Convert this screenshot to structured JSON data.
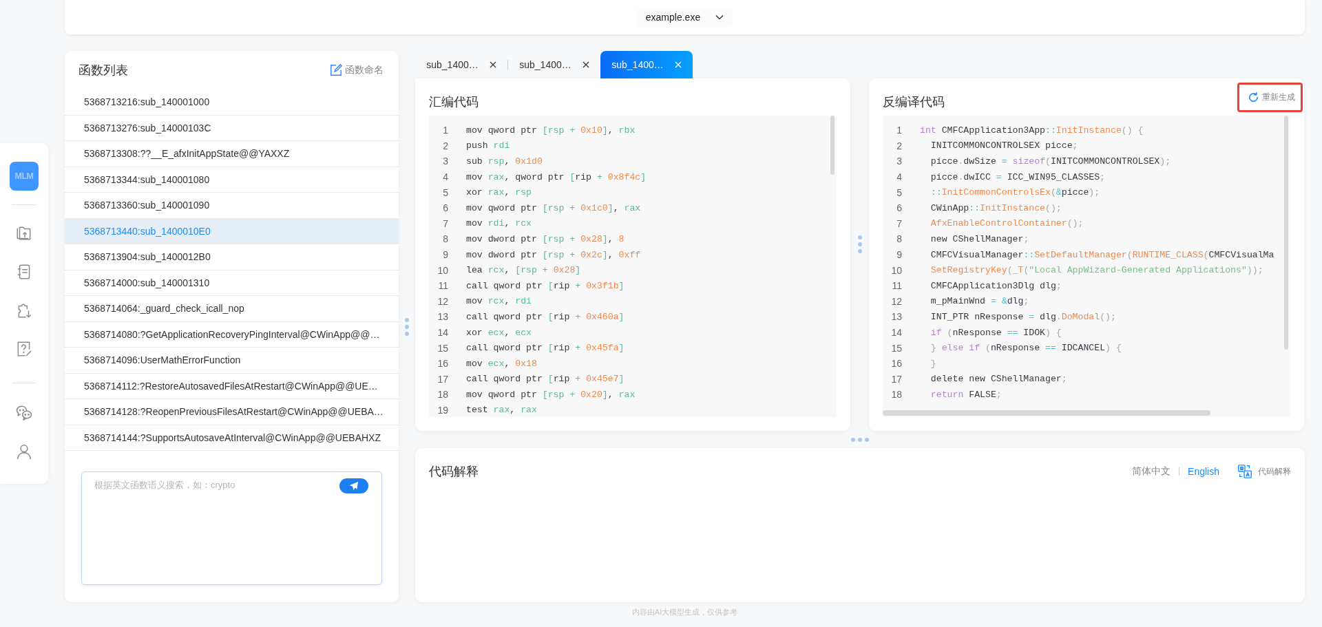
{
  "top_bar": {
    "file_select": "example.exe"
  },
  "rail": {
    "logo": "MLM"
  },
  "function_list": {
    "title": "函数列表",
    "rename_button": "函数命名",
    "items": [
      {
        "label": "5368713216:sub_140001000",
        "selected": false
      },
      {
        "label": "5368713276:sub_14000103C",
        "selected": false
      },
      {
        "label": "5368713308:??__E_afxInitAppState@@YAXXZ",
        "selected": false
      },
      {
        "label": "5368713344:sub_140001080",
        "selected": false
      },
      {
        "label": "5368713360:sub_140001090",
        "selected": false
      },
      {
        "label": "5368713440:sub_1400010E0",
        "selected": true
      },
      {
        "label": "5368713904:sub_1400012B0",
        "selected": false
      },
      {
        "label": "5368714000:sub_140001310",
        "selected": false
      },
      {
        "label": "5368714064:_guard_check_icall_nop",
        "selected": false
      },
      {
        "label": "5368714080:?GetApplicationRecoveryPingInterval@CWinApp@@…",
        "selected": false
      },
      {
        "label": "5368714096:UserMathErrorFunction",
        "selected": false
      },
      {
        "label": "5368714112:?RestoreAutosavedFilesAtRestart@CWinApp@@UE…",
        "selected": false
      },
      {
        "label": "5368714128:?ReopenPreviousFilesAtRestart@CWinApp@@UEBA…",
        "selected": false
      },
      {
        "label": "5368714144:?SupportsAutosaveAtInterval@CWinApp@@UEBAHXZ",
        "selected": false
      }
    ],
    "search": {
      "placeholder": "根据英文函数语义搜索，如：crypto"
    }
  },
  "tabs": [
    {
      "label": "sub_1400…",
      "selected": false
    },
    {
      "label": "sub_1400…",
      "selected": false
    },
    {
      "label": "sub_1400…",
      "selected": true
    }
  ],
  "assembly": {
    "title": "汇编代码",
    "lines": [
      {
        "number": "1",
        "tokens": [
          {
            "kind": "plain",
            "text": "mov qword ptr "
          },
          {
            "kind": "accent",
            "text": "[rsp + "
          },
          {
            "kind": "number",
            "text": "0x10"
          },
          {
            "kind": "accent",
            "text": "]"
          },
          {
            "kind": "plain",
            "text": ", "
          },
          {
            "kind": "accent",
            "text": "rbx"
          }
        ]
      },
      {
        "number": "2",
        "tokens": [
          {
            "kind": "plain",
            "text": "push "
          },
          {
            "kind": "accent",
            "text": "rdi"
          }
        ]
      },
      {
        "number": "3",
        "tokens": [
          {
            "kind": "plain",
            "text": "sub "
          },
          {
            "kind": "accent",
            "text": "rsp"
          },
          {
            "kind": "plain",
            "text": ", "
          },
          {
            "kind": "number",
            "text": "0x1d0"
          }
        ]
      },
      {
        "number": "4",
        "tokens": [
          {
            "kind": "plain",
            "text": "mov "
          },
          {
            "kind": "accent",
            "text": "rax"
          },
          {
            "kind": "plain",
            "text": ", qword ptr "
          },
          {
            "kind": "accent",
            "text": "["
          },
          {
            "kind": "plain",
            "text": "rip "
          },
          {
            "kind": "accent",
            "text": "+ "
          },
          {
            "kind": "number",
            "text": "0x8f4c"
          },
          {
            "kind": "accent",
            "text": "]"
          }
        ]
      },
      {
        "number": "5",
        "tokens": [
          {
            "kind": "plain",
            "text": "xor "
          },
          {
            "kind": "accent",
            "text": "rax"
          },
          {
            "kind": "plain",
            "text": ", "
          },
          {
            "kind": "accent",
            "text": "rsp"
          }
        ]
      },
      {
        "number": "6",
        "tokens": [
          {
            "kind": "plain",
            "text": "mov qword ptr "
          },
          {
            "kind": "accent",
            "text": "[rsp + "
          },
          {
            "kind": "number",
            "text": "0x1c0"
          },
          {
            "kind": "accent",
            "text": "]"
          },
          {
            "kind": "plain",
            "text": ", "
          },
          {
            "kind": "accent",
            "text": "rax"
          }
        ]
      },
      {
        "number": "7",
        "tokens": [
          {
            "kind": "plain",
            "text": "mov "
          },
          {
            "kind": "accent",
            "text": "rdi"
          },
          {
            "kind": "plain",
            "text": ", "
          },
          {
            "kind": "accent",
            "text": "rcx"
          }
        ]
      },
      {
        "number": "8",
        "tokens": [
          {
            "kind": "plain",
            "text": "mov dword ptr "
          },
          {
            "kind": "accent",
            "text": "[rsp + "
          },
          {
            "kind": "number",
            "text": "0x28"
          },
          {
            "kind": "accent",
            "text": "]"
          },
          {
            "kind": "plain",
            "text": ", "
          },
          {
            "kind": "number",
            "text": "8"
          }
        ]
      },
      {
        "number": "9",
        "tokens": [
          {
            "kind": "plain",
            "text": "mov dword ptr "
          },
          {
            "kind": "accent",
            "text": "[rsp + "
          },
          {
            "kind": "number",
            "text": "0x2c"
          },
          {
            "kind": "accent",
            "text": "]"
          },
          {
            "kind": "plain",
            "text": ", "
          },
          {
            "kind": "number",
            "text": "0xff"
          }
        ]
      },
      {
        "number": "10",
        "tokens": [
          {
            "kind": "plain",
            "text": "lea "
          },
          {
            "kind": "accent",
            "text": "rcx"
          },
          {
            "kind": "plain",
            "text": ", "
          },
          {
            "kind": "accent",
            "text": "[rsp + "
          },
          {
            "kind": "number",
            "text": "0x28"
          },
          {
            "kind": "accent",
            "text": "]"
          }
        ]
      },
      {
        "number": "11",
        "tokens": [
          {
            "kind": "plain",
            "text": "call qword ptr "
          },
          {
            "kind": "accent",
            "text": "["
          },
          {
            "kind": "plain",
            "text": "rip "
          },
          {
            "kind": "accent",
            "text": "+ "
          },
          {
            "kind": "number",
            "text": "0x3f1b"
          },
          {
            "kind": "accent",
            "text": "]"
          }
        ]
      },
      {
        "number": "12",
        "tokens": [
          {
            "kind": "plain",
            "text": "mov "
          },
          {
            "kind": "accent",
            "text": "rcx"
          },
          {
            "kind": "plain",
            "text": ", "
          },
          {
            "kind": "accent",
            "text": "rdi"
          }
        ]
      },
      {
        "number": "13",
        "tokens": [
          {
            "kind": "plain",
            "text": "call qword ptr "
          },
          {
            "kind": "accent",
            "text": "["
          },
          {
            "kind": "plain",
            "text": "rip "
          },
          {
            "kind": "accent",
            "text": "+ "
          },
          {
            "kind": "number",
            "text": "0x460a"
          },
          {
            "kind": "accent",
            "text": "]"
          }
        ]
      },
      {
        "number": "14",
        "tokens": [
          {
            "kind": "plain",
            "text": "xor "
          },
          {
            "kind": "accent",
            "text": "ecx"
          },
          {
            "kind": "plain",
            "text": ", "
          },
          {
            "kind": "accent",
            "text": "ecx"
          }
        ]
      },
      {
        "number": "15",
        "tokens": [
          {
            "kind": "plain",
            "text": "call qword ptr "
          },
          {
            "kind": "accent",
            "text": "["
          },
          {
            "kind": "plain",
            "text": "rip "
          },
          {
            "kind": "accent",
            "text": "+ "
          },
          {
            "kind": "number",
            "text": "0x45fa"
          },
          {
            "kind": "accent",
            "text": "]"
          }
        ]
      },
      {
        "number": "16",
        "tokens": [
          {
            "kind": "plain",
            "text": "mov "
          },
          {
            "kind": "accent",
            "text": "ecx"
          },
          {
            "kind": "plain",
            "text": ", "
          },
          {
            "kind": "number",
            "text": "0x18"
          }
        ]
      },
      {
        "number": "17",
        "tokens": [
          {
            "kind": "plain",
            "text": "call qword ptr "
          },
          {
            "kind": "accent",
            "text": "["
          },
          {
            "kind": "plain",
            "text": "rip "
          },
          {
            "kind": "accent",
            "text": "+ "
          },
          {
            "kind": "number",
            "text": "0x45e7"
          },
          {
            "kind": "accent",
            "text": "]"
          }
        ]
      },
      {
        "number": "18",
        "tokens": [
          {
            "kind": "plain",
            "text": "mov qword ptr "
          },
          {
            "kind": "accent",
            "text": "[rsp + "
          },
          {
            "kind": "number",
            "text": "0x20"
          },
          {
            "kind": "accent",
            "text": "]"
          },
          {
            "kind": "plain",
            "text": ", "
          },
          {
            "kind": "accent",
            "text": "rax"
          }
        ]
      },
      {
        "number": "19",
        "tokens": [
          {
            "kind": "plain",
            "text": "test "
          },
          {
            "kind": "accent",
            "text": "rax"
          },
          {
            "kind": "plain",
            "text": ", "
          },
          {
            "kind": "accent",
            "text": "rax"
          }
        ]
      }
    ]
  },
  "decompiled": {
    "title": "反编译代码",
    "regenerate_button": {
      "label": "重新生成",
      "highlighted": true
    },
    "lines": [
      {
        "number": "1",
        "tokens": [
          {
            "kind": "keyword",
            "text": "int"
          },
          {
            "kind": "plain",
            "text": " CMFCApplication3App"
          },
          {
            "kind": "operator",
            "text": "::"
          },
          {
            "kind": "function",
            "text": "InitInstance"
          },
          {
            "kind": "punct",
            "text": "() {"
          }
        ]
      },
      {
        "number": "2",
        "tokens": [
          {
            "kind": "plain",
            "text": "  INITCOMMONCONTROLSEX picce"
          },
          {
            "kind": "punct",
            "text": ";"
          }
        ]
      },
      {
        "number": "3",
        "tokens": [
          {
            "kind": "plain",
            "text": "  picce"
          },
          {
            "kind": "punct",
            "text": "."
          },
          {
            "kind": "plain",
            "text": "dwSize "
          },
          {
            "kind": "operator",
            "text": "="
          },
          {
            "kind": "keyword",
            "text": " sizeof"
          },
          {
            "kind": "punct",
            "text": "("
          },
          {
            "kind": "plain",
            "text": "INITCOMMONCONTROLSEX"
          },
          {
            "kind": "punct",
            "text": ");"
          }
        ]
      },
      {
        "number": "4",
        "tokens": [
          {
            "kind": "plain",
            "text": "  picce"
          },
          {
            "kind": "punct",
            "text": "."
          },
          {
            "kind": "plain",
            "text": "dwICC "
          },
          {
            "kind": "operator",
            "text": "="
          },
          {
            "kind": "plain",
            "text": " ICC_WIN95_CLASSES"
          },
          {
            "kind": "punct",
            "text": ";"
          }
        ]
      },
      {
        "number": "5",
        "tokens": [
          {
            "kind": "operator",
            "text": "  ::"
          },
          {
            "kind": "function",
            "text": "InitCommonControlsEx"
          },
          {
            "kind": "punct",
            "text": "("
          },
          {
            "kind": "operator",
            "text": "&"
          },
          {
            "kind": "plain",
            "text": "picce"
          },
          {
            "kind": "punct",
            "text": ");"
          }
        ]
      },
      {
        "number": "6",
        "tokens": [
          {
            "kind": "plain",
            "text": "  CWinApp"
          },
          {
            "kind": "operator",
            "text": "::"
          },
          {
            "kind": "function",
            "text": "InitInstance"
          },
          {
            "kind": "punct",
            "text": "();"
          }
        ]
      },
      {
        "number": "7",
        "tokens": [
          {
            "kind": "function",
            "text": "  AfxEnableControlContainer"
          },
          {
            "kind": "punct",
            "text": "();"
          }
        ]
      },
      {
        "number": "8",
        "tokens": [
          {
            "kind": "plain",
            "text": "  new CShellManager"
          },
          {
            "kind": "punct",
            "text": ";"
          }
        ]
      },
      {
        "number": "9",
        "tokens": [
          {
            "kind": "plain",
            "text": "  CMFCVisualManager"
          },
          {
            "kind": "operator",
            "text": "::"
          },
          {
            "kind": "function",
            "text": "SetDefaultManager"
          },
          {
            "kind": "punct",
            "text": "("
          },
          {
            "kind": "function",
            "text": "RUNTIME_CLASS"
          },
          {
            "kind": "punct",
            "text": "("
          },
          {
            "kind": "plain",
            "text": "CMFCVisualMa"
          }
        ]
      },
      {
        "number": "10",
        "tokens": [
          {
            "kind": "function",
            "text": "  SetRegistryKey"
          },
          {
            "kind": "punct",
            "text": "("
          },
          {
            "kind": "function",
            "text": "_T"
          },
          {
            "kind": "punct",
            "text": "("
          },
          {
            "kind": "string",
            "text": "\"Local AppWizard-Generated Applications\""
          },
          {
            "kind": "punct",
            "text": "));"
          }
        ]
      },
      {
        "number": "11",
        "tokens": [
          {
            "kind": "plain",
            "text": "  CMFCApplication3Dlg dlg"
          },
          {
            "kind": "punct",
            "text": ";"
          }
        ]
      },
      {
        "number": "12",
        "tokens": [
          {
            "kind": "plain",
            "text": "  m_pMainWnd "
          },
          {
            "kind": "operator",
            "text": "= &"
          },
          {
            "kind": "plain",
            "text": "dlg"
          },
          {
            "kind": "punct",
            "text": ";"
          }
        ]
      },
      {
        "number": "13",
        "tokens": [
          {
            "kind": "plain",
            "text": "  INT_PTR nResponse "
          },
          {
            "kind": "operator",
            "text": "="
          },
          {
            "kind": "plain",
            "text": " dlg"
          },
          {
            "kind": "punct",
            "text": "."
          },
          {
            "kind": "function",
            "text": "DoModal"
          },
          {
            "kind": "punct",
            "text": "();"
          }
        ]
      },
      {
        "number": "14",
        "tokens": [
          {
            "kind": "keyword",
            "text": "  if"
          },
          {
            "kind": "punct",
            "text": " ("
          },
          {
            "kind": "plain",
            "text": "nResponse "
          },
          {
            "kind": "operator",
            "text": "=="
          },
          {
            "kind": "plain",
            "text": " IDOK"
          },
          {
            "kind": "punct",
            "text": ") {"
          }
        ]
      },
      {
        "number": "15",
        "tokens": [
          {
            "kind": "punct",
            "text": "  } "
          },
          {
            "kind": "keyword",
            "text": "else if"
          },
          {
            "kind": "punct",
            "text": " ("
          },
          {
            "kind": "plain",
            "text": "nResponse "
          },
          {
            "kind": "operator",
            "text": "=="
          },
          {
            "kind": "plain",
            "text": " IDCANCEL"
          },
          {
            "kind": "punct",
            "text": ") {"
          }
        ]
      },
      {
        "number": "16",
        "tokens": [
          {
            "kind": "punct",
            "text": "  }"
          }
        ]
      },
      {
        "number": "17",
        "tokens": [
          {
            "kind": "plain",
            "text": "  delete new CShellManager"
          },
          {
            "kind": "punct",
            "text": ";"
          }
        ]
      },
      {
        "number": "18",
        "tokens": [
          {
            "kind": "keyword",
            "text": "  return"
          },
          {
            "kind": "plain",
            "text": " FALSE"
          },
          {
            "kind": "punct",
            "text": ";"
          }
        ]
      }
    ]
  },
  "explanation": {
    "title": "代码解释",
    "languages": [
      {
        "label": "简体中文",
        "selected": false
      },
      {
        "label": "English",
        "selected": true
      }
    ],
    "explain_button": "代码解释"
  },
  "footer": "内容由AI大模型生成，仅供参考"
}
